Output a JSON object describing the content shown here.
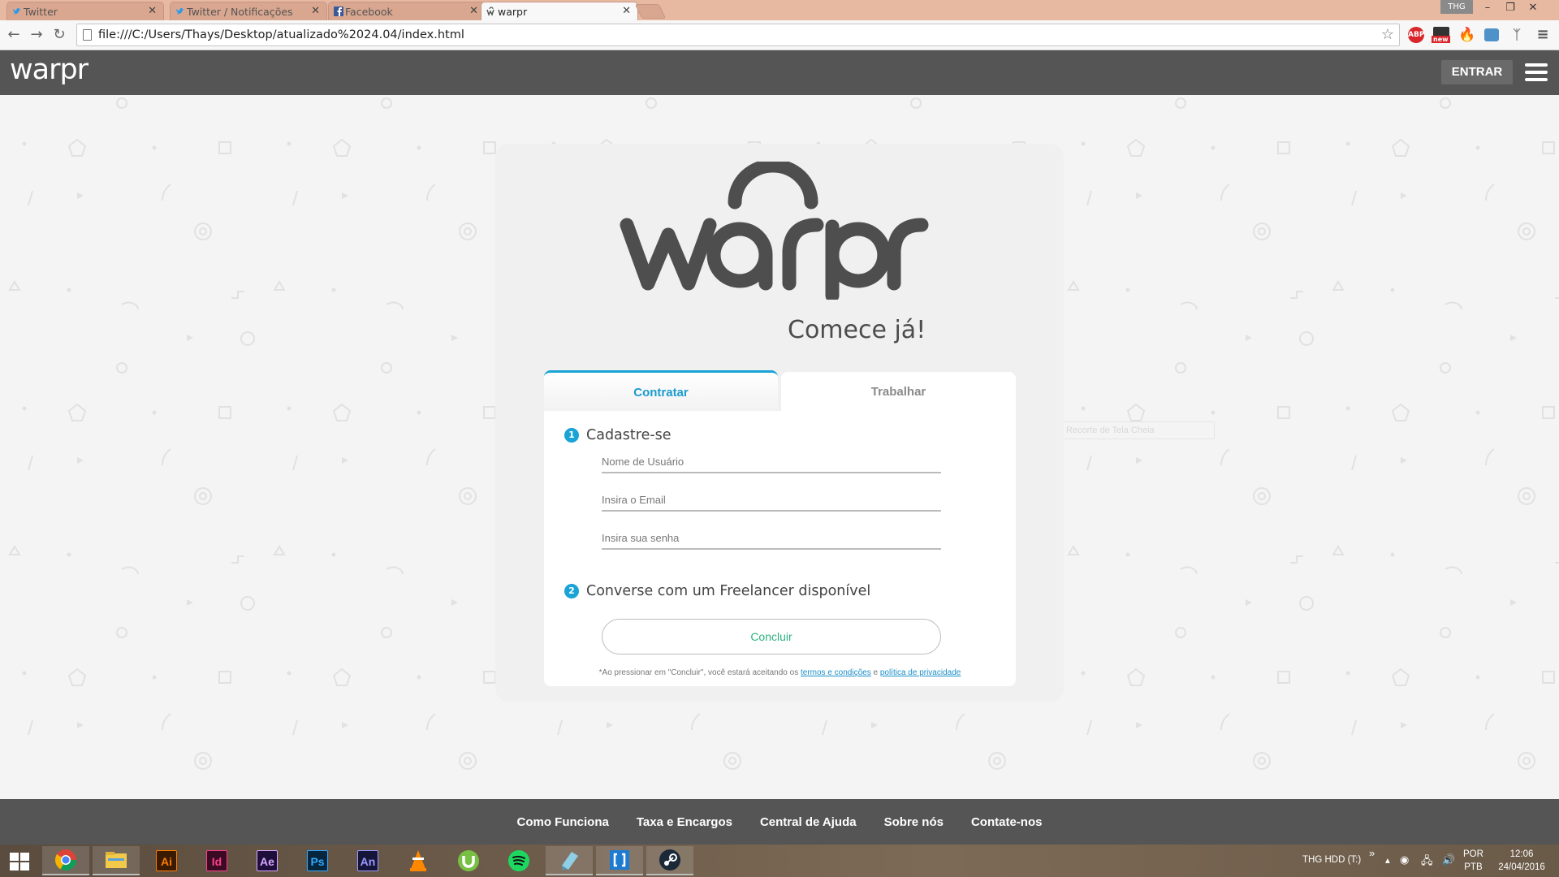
{
  "browser": {
    "tabs": [
      {
        "label": "Twitter",
        "icon": "twitter-icon"
      },
      {
        "label": "Twitter / Notificações",
        "icon": "twitter-icon"
      },
      {
        "label": "Facebook",
        "icon": "facebook-icon"
      },
      {
        "label": "warpr",
        "icon": "warpr-icon",
        "active": true
      }
    ],
    "user_badge": "THG",
    "url": "file:///C:/Users/Thays/Desktop/atualizado%2024.04/index.html",
    "extensions": {
      "abp_label": "ABP",
      "new_label": "new"
    }
  },
  "header": {
    "logo": "warpr",
    "login_label": "ENTRAR"
  },
  "hero": {
    "logo": "warpr",
    "tagline": "Comece já!"
  },
  "tabs": {
    "hire": "Contratar",
    "work": "Trabalhar"
  },
  "form": {
    "step1_num": "1",
    "step1": "Cadastre-se",
    "username_placeholder": "Nome de Usuário",
    "email_placeholder": "Insira o Email",
    "password_placeholder": "Insira sua senha",
    "step2_num": "2",
    "step2": "Converse com um Freelancer disponível",
    "submit_label": "Concluir",
    "terms_prefix": "*Ao pressionar em \"Concluir\", você estará aceitando os",
    "terms_link": "termos e condições",
    "terms_mid": "e",
    "privacy_link": "política de privacidade"
  },
  "ghost_field": "Recorte de Tela Cheia",
  "footer": {
    "links": [
      "Como Funciona",
      "Taxa e Encargos",
      "Central de Ajuda",
      "Sobre nós",
      "Contate-nos"
    ]
  },
  "taskbar": {
    "apps": [
      {
        "label": "",
        "icon": "chrome-icon"
      },
      {
        "label": "",
        "icon": "file-explorer-icon"
      },
      {
        "label": "Ai",
        "icon": "illustrator-icon",
        "color": "#ff7c00",
        "bg": "#3a1a00"
      },
      {
        "label": "Id",
        "icon": "indesign-icon",
        "color": "#ff3d8b",
        "bg": "#3a0b22"
      },
      {
        "label": "Ae",
        "icon": "after-effects-icon",
        "color": "#d8a7ff",
        "bg": "#1e0f3a"
      },
      {
        "label": "Ps",
        "icon": "photoshop-icon",
        "color": "#31a8ff",
        "bg": "#06263d"
      },
      {
        "label": "An",
        "icon": "animate-icon",
        "color": "#9a9aff",
        "bg": "#15153a"
      },
      {
        "label": "",
        "icon": "vlc-icon"
      },
      {
        "label": "",
        "icon": "utorrent-icon"
      },
      {
        "label": "",
        "icon": "spotify-icon"
      },
      {
        "label": "",
        "icon": "notepad-icon"
      },
      {
        "label": "",
        "icon": "brackets-icon"
      },
      {
        "label": "",
        "icon": "steam-icon"
      }
    ],
    "drive_label": "THG HDD (T:)",
    "chevron": "»",
    "language_top": "POR",
    "language_bottom": "PTB",
    "time": "12:06",
    "date": "24/04/2016"
  }
}
